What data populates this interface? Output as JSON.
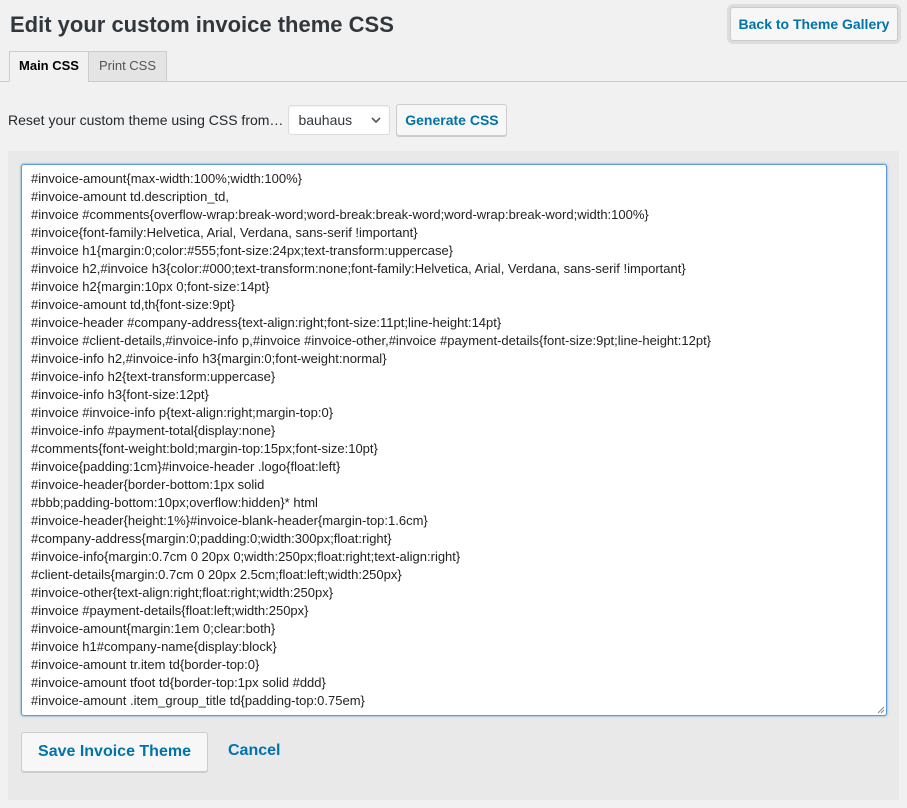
{
  "header": {
    "title": "Edit your custom invoice theme CSS",
    "back_button": "Back to Theme Gallery"
  },
  "tabs": [
    {
      "label": "Main CSS",
      "active": true
    },
    {
      "label": "Print CSS",
      "active": false
    }
  ],
  "reset": {
    "label": "Reset your custom theme using CSS from…",
    "selected_theme": "bauhaus",
    "generate_button": "Generate CSS"
  },
  "editor": {
    "lines": [
      "#invoice-amount{max-width:100%;width:100%}",
      "#invoice-amount td.description_td,",
      "#invoice #comments{overflow-wrap:break-word;word-break:break-word;word-wrap:break-word;width:100%}",
      "#invoice{font-family:Helvetica, Arial, Verdana, sans-serif !important}",
      "#invoice h1{margin:0;color:#555;font-size:24px;text-transform:uppercase}",
      "#invoice h2,#invoice h3{color:#000;text-transform:none;font-family:Helvetica, Arial, Verdana, sans-serif !important}",
      "#invoice h2{margin:10px 0;font-size:14pt}",
      "#invoice-amount td,th{font-size:9pt}",
      "#invoice-header #company-address{text-align:right;font-size:11pt;line-height:14pt}",
      "#invoice #client-details,#invoice-info p,#invoice #invoice-other,#invoice #payment-details{font-size:9pt;line-height:12pt}",
      "#invoice-info h2,#invoice-info h3{margin:0;font-weight:normal}",
      "#invoice-info h2{text-transform:uppercase}",
      "#invoice-info h3{font-size:12pt}",
      "#invoice #invoice-info p{text-align:right;margin-top:0}",
      "#invoice-info #payment-total{display:none}",
      "#comments{font-weight:bold;margin-top:15px;font-size:10pt}",
      "#invoice{padding:1cm}#invoice-header .logo{float:left}",
      "#invoice-header{border-bottom:1px solid",
      "#bbb;padding-bottom:10px;overflow:hidden}* html",
      "#invoice-header{height:1%}#invoice-blank-header{margin-top:1.6cm}",
      "#company-address{margin:0;padding:0;width:300px;float:right}",
      "#invoice-info{margin:0.7cm 0 20px 0;width:250px;float:right;text-align:right}",
      "#client-details{margin:0.7cm 0 20px 2.5cm;float:left;width:250px}",
      "#invoice-other{text-align:right;float:right;width:250px}",
      "#invoice #payment-details{float:left;width:250px}",
      "#invoice-amount{margin:1em 0;clear:both}",
      "#invoice h1#company-name{display:block}",
      "#invoice-amount tr.item td{border-top:0}",
      "#invoice-amount tfoot td{border-top:1px solid #ddd}",
      "#invoice-amount .item_group_title td{padding-top:0.75em}"
    ]
  },
  "footer": {
    "save_button": "Save Invoice Theme",
    "cancel_link": "Cancel"
  },
  "icons": {
    "select_arrow": "chevron-down-icon",
    "resize": "resize-grip-icon"
  },
  "colors": {
    "link": "#0073aa",
    "focus_border": "#5b9dd9"
  }
}
